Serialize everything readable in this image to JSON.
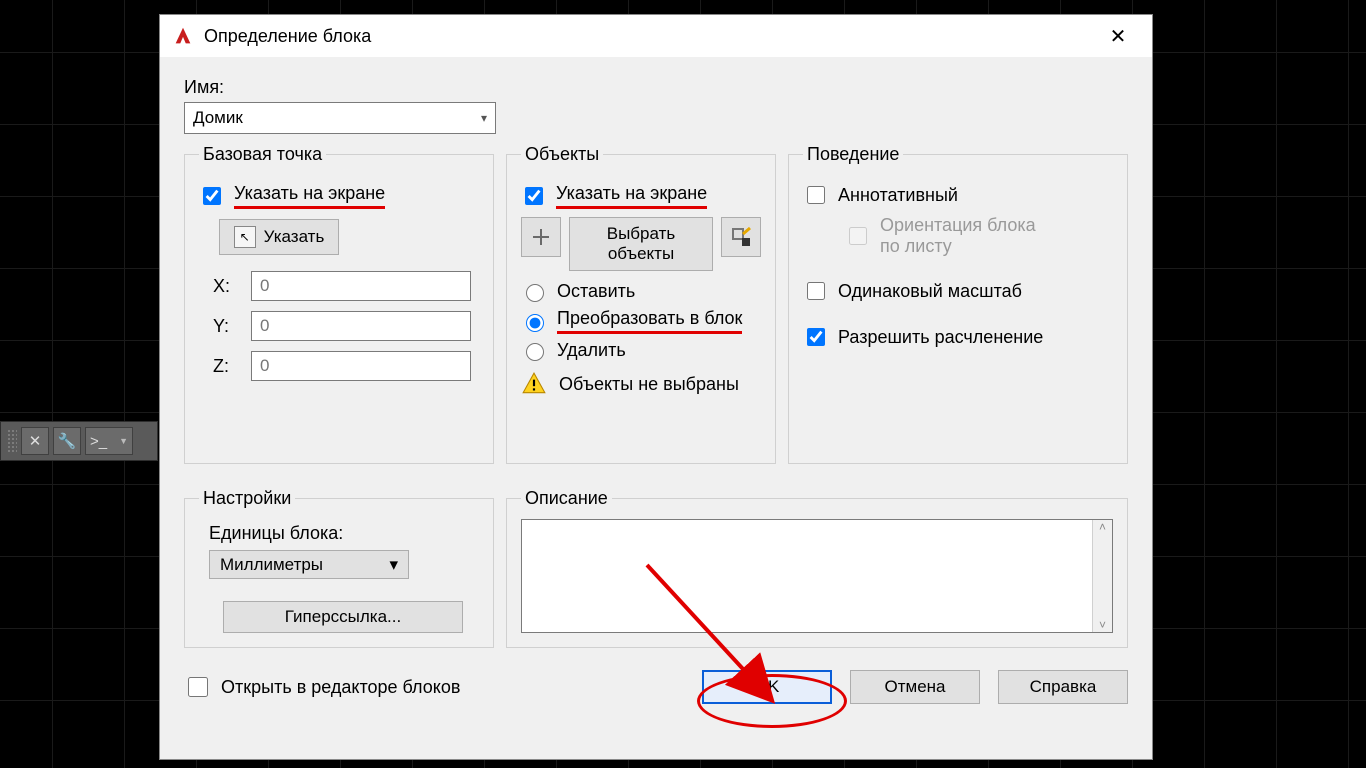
{
  "dialog": {
    "title": "Определение блока",
    "close_glyph": "✕"
  },
  "name": {
    "label": "Имя:",
    "value": "Домик"
  },
  "toolbar": {
    "btn_close": "✕",
    "btn_wrench": "🔧",
    "btn_cmd": ">_"
  },
  "base_point": {
    "legend": "Базовая точка",
    "specify_onscreen": "Указать на экране",
    "specify_onscreen_checked": true,
    "pick_label": "Указать",
    "x_label": "X:",
    "x_val": "0",
    "y_label": "Y:",
    "y_val": "0",
    "z_label": "Z:",
    "z_val": "0"
  },
  "objects": {
    "legend": "Объекты",
    "specify_onscreen": "Указать на экране",
    "specify_onscreen_checked": true,
    "select_label_1": "Выбрать",
    "select_label_2": "объекты",
    "opt_keep": "Оставить",
    "opt_convert": "Преобразовать в блок",
    "opt_delete": "Удалить",
    "selected_option": "convert",
    "warn_text": "Объекты не выбраны"
  },
  "behavior": {
    "legend": "Поведение",
    "annotative": "Аннотативный",
    "annotative_checked": false,
    "orient_label_1": "Ориентация блока",
    "orient_label_2": "по листу",
    "uniform_scale": "Одинаковый масштаб",
    "uniform_scale_checked": false,
    "allow_explode": "Разрешить расчленение",
    "allow_explode_checked": true
  },
  "settings": {
    "legend": "Настройки",
    "units_label": "Единицы блока:",
    "units_value": "Миллиметры",
    "hyperlink_label": "Гиперссылка..."
  },
  "description": {
    "legend": "Описание",
    "value": ""
  },
  "footer": {
    "open_editor": "Открыть в редакторе блоков",
    "open_editor_checked": false,
    "ok": "OK",
    "cancel": "Отмена",
    "help": "Справка"
  }
}
